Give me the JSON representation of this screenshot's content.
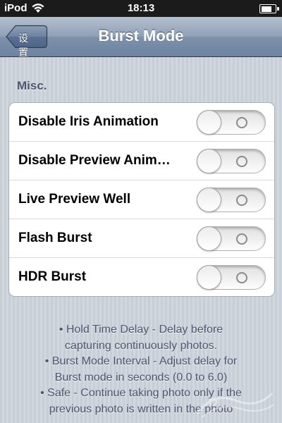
{
  "status_bar": {
    "carrier": "iPod",
    "time": "18:13",
    "battery_level": 0.9
  },
  "nav": {
    "title": "Burst Mode",
    "back_label": "设置"
  },
  "section": {
    "header": "Misc."
  },
  "rows": [
    {
      "label": "Disable Iris Animation",
      "switch_on": false
    },
    {
      "label": "Disable Preview Anim…",
      "switch_on": false
    },
    {
      "label": "Live Preview Well",
      "switch_on": false
    },
    {
      "label": "Flash Burst",
      "switch_on": false
    },
    {
      "label": "HDR Burst",
      "switch_on": false
    }
  ],
  "footer": {
    "lines": [
      "• Hold Time Delay - Delay before",
      "capturing continuously photos.",
      "• Burst Mode Interval - Adjust delay for",
      "Burst mode in seconds (0.0 to 6.0)",
      "• Safe - Continue taking photo only if the",
      "previous photo is written in the photo"
    ]
  },
  "colors": {
    "nav_gradient_top": "#b4c0cf",
    "nav_gradient_bottom": "#6d83a0",
    "background": "#cbd2d9",
    "section_text": "#4c566c"
  },
  "icons": {
    "wifi": "wifi-icon",
    "battery": "battery-icon",
    "back": "back-arrow-icon",
    "switch_off": "switch-off-icon"
  }
}
